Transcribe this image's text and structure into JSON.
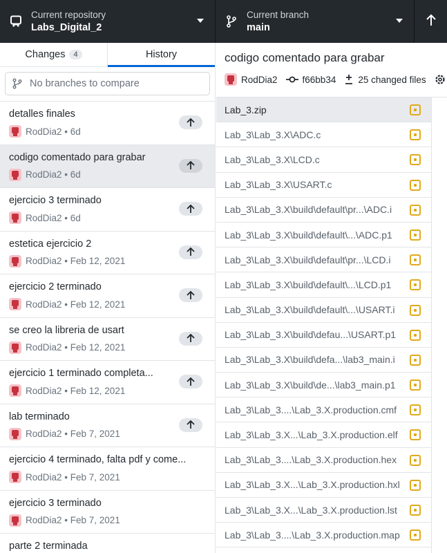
{
  "toolbar": {
    "repo_caption": "Current repository",
    "repo_name": "Labs_Digital_2",
    "branch_caption": "Current branch",
    "branch_name": "main"
  },
  "tabs": {
    "changes_label": "Changes",
    "changes_count": "4",
    "history_label": "History"
  },
  "compare": {
    "placeholder": "No branches to compare"
  },
  "commits": [
    {
      "title": "detalles finales",
      "author": "RodDia2",
      "date": "6d"
    },
    {
      "title": "codigo comentado para grabar",
      "author": "RodDia2",
      "date": "6d"
    },
    {
      "title": "ejercicio 3 terminado",
      "author": "RodDia2",
      "date": "6d"
    },
    {
      "title": "estetica ejercicio 2",
      "author": "RodDia2",
      "date": "Feb 12, 2021"
    },
    {
      "title": "ejercicio 2 terminado",
      "author": "RodDia2",
      "date": "Feb 12, 2021"
    },
    {
      "title": "se creo la libreria de usart",
      "author": "RodDia2",
      "date": "Feb 12, 2021"
    },
    {
      "title": "ejercicio 1 terminado completa...",
      "author": "RodDia2",
      "date": "Feb 12, 2021"
    },
    {
      "title": "lab terminado",
      "author": "RodDia2",
      "date": "Feb 7, 2021"
    },
    {
      "title": "ejercicio 4 terminado, falta pdf y come...",
      "author": "RodDia2",
      "date": "Feb 7, 2021"
    },
    {
      "title": "ejercicio 3 terminado",
      "author": "RodDia2",
      "date": "Feb 7, 2021"
    },
    {
      "title": "parte 2 terminada",
      "author": "",
      "date": ""
    }
  ],
  "detail": {
    "title": "codigo comentado para grabar",
    "author": "RodDia2",
    "sha": "f66bb34",
    "changed_files": "25 changed files"
  },
  "files": [
    "Lab_3.zip",
    "Lab_3\\Lab_3.X\\ADC.c",
    "Lab_3\\Lab_3.X\\LCD.c",
    "Lab_3\\Lab_3.X\\USART.c",
    "Lab_3\\Lab_3.X\\build\\default\\pr...\\ADC.i",
    "Lab_3\\Lab_3.X\\build\\default\\...\\ADC.p1",
    "Lab_3\\Lab_3.X\\build\\default\\pr...\\LCD.i",
    "Lab_3\\Lab_3.X\\build\\default\\...\\LCD.p1",
    "Lab_3\\Lab_3.X\\build\\default\\...\\USART.i",
    "Lab_3\\Lab_3.X\\build\\defau...\\USART.p1",
    "Lab_3\\Lab_3.X\\build\\defa...\\lab3_main.i",
    "Lab_3\\Lab_3.X\\build\\de...\\lab3_main.p1",
    "Lab_3\\Lab_3....\\Lab_3.X.production.cmf",
    "Lab_3\\Lab_3.X...\\Lab_3.X.production.elf",
    "Lab_3\\Lab_3....\\Lab_3.X.production.hex",
    "Lab_3\\Lab_3.X...\\Lab_3.X.production.hxl",
    "Lab_3\\Lab_3.X...\\Lab_3.X.production.lst",
    "Lab_3\\Lab_3....\\Lab_3.X.production.map"
  ],
  "colors": {
    "toolbar_bg": "#24292e",
    "accent_blue": "#0366d6",
    "modified_status": "#e1a91c",
    "selected_row": "#e8eaed"
  },
  "icons": {
    "repo": "desktop-repo-icon",
    "branch": "git-branch-icon",
    "push": "arrow-up-icon",
    "compare": "git-branch-icon",
    "sha": "git-commit-icon",
    "changed_files": "diff-icon",
    "file_status": "file-modified-icon"
  }
}
